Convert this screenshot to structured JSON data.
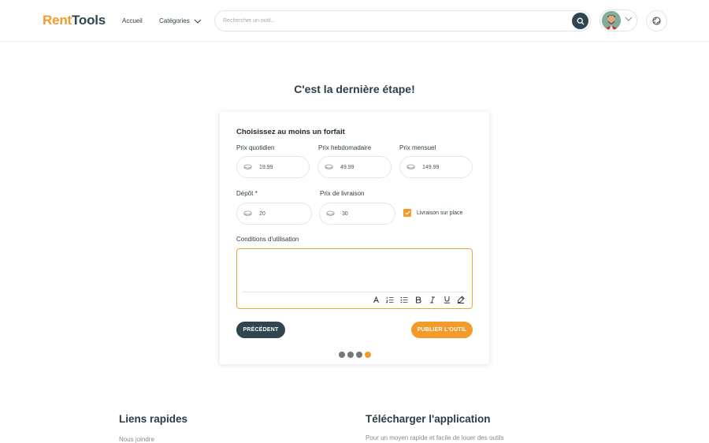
{
  "header": {
    "logo_part1": "Rent",
    "logo_part2": "Tools",
    "nav_home": "Accueil",
    "nav_categories": "Catégories",
    "search_placeholder": "Rechercher un outil..."
  },
  "page": {
    "title": "C'est la dernière étape!"
  },
  "form": {
    "title": "Choisissez au moins un forfait",
    "daily_label": "Prix quotidien",
    "daily_value": "19.99",
    "weekly_label": "Prix hebdomadaire",
    "weekly_value": "49.99",
    "monthly_label": "Prix mensuel",
    "monthly_value": "149.99",
    "deposit_label": "Dépôt *",
    "deposit_value": "20",
    "delivery_label": "Prix de livraison",
    "delivery_value": "30",
    "onsite_label": "Livraison sur place",
    "onsite_checked": true,
    "conditions_label": "Conditions d'utilisation",
    "prev_button": "PRÉCÉDENT",
    "publish_button": "PUBLIER L'OUTIL",
    "steps_total": 4,
    "step_current": 4
  },
  "editor_tools": [
    "font-size-icon",
    "ordered-list-icon",
    "bullet-list-icon",
    "bold-icon",
    "italic-icon",
    "underline-icon",
    "highlight-icon"
  ],
  "footer": {
    "links_title": "Liens rapides",
    "links_item": "Nous joindre",
    "app_title": "Télécharger l'application",
    "app_text": "Pour un moyen rapide et facile de louer des outils"
  },
  "colors": {
    "accent": "#f39a2b",
    "dark": "#2f4550"
  }
}
